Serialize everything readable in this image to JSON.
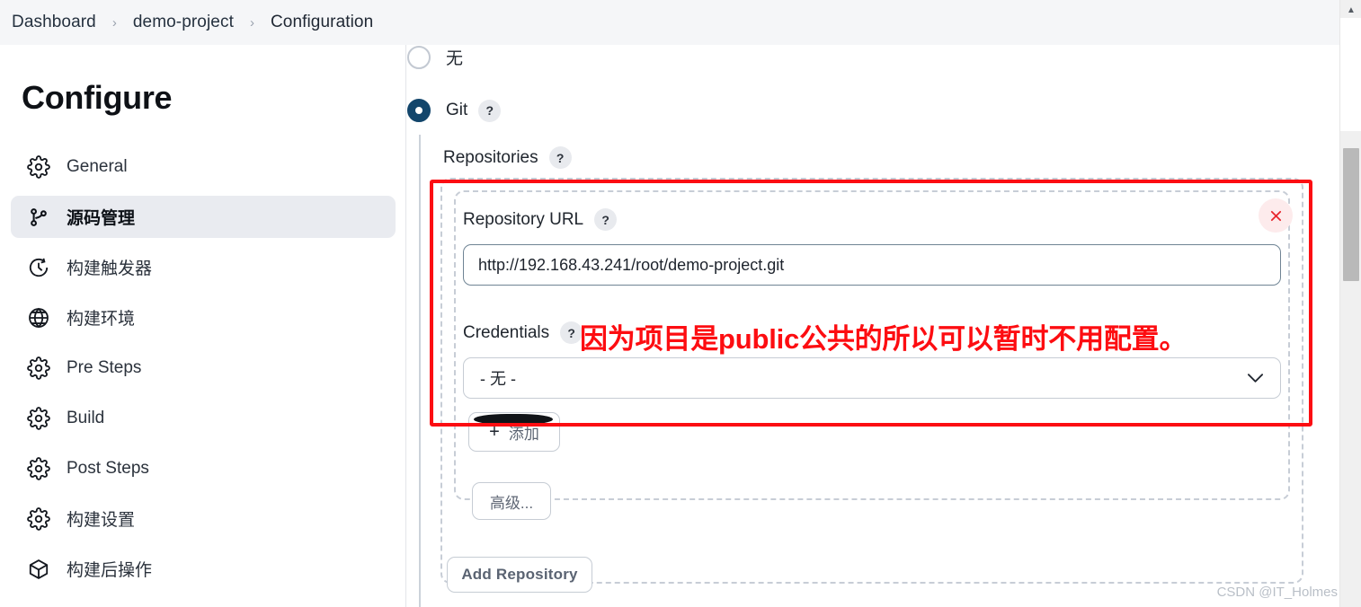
{
  "breadcrumb": {
    "items": [
      {
        "label": "Dashboard"
      },
      {
        "label": "demo-project"
      },
      {
        "label": "Configuration"
      }
    ],
    "separator": "›"
  },
  "sidebar": {
    "title": "Configure",
    "items": [
      {
        "label": "General",
        "icon": "gear-icon",
        "active": false
      },
      {
        "label": "源码管理",
        "icon": "git-branch-icon",
        "active": true
      },
      {
        "label": "构建触发器",
        "icon": "clock-icon",
        "active": false
      },
      {
        "label": "构建环境",
        "icon": "globe-icon",
        "active": false
      },
      {
        "label": "Pre Steps",
        "icon": "gear-icon",
        "active": false
      },
      {
        "label": "Build",
        "icon": "gear-icon",
        "active": false
      },
      {
        "label": "Post Steps",
        "icon": "gear-icon",
        "active": false
      },
      {
        "label": "构建设置",
        "icon": "gear-icon",
        "active": false
      },
      {
        "label": "构建后操作",
        "icon": "package-icon",
        "active": false
      }
    ]
  },
  "scm": {
    "options": [
      {
        "label": "无",
        "checked": false
      },
      {
        "label": "Git",
        "checked": true,
        "help": "?"
      }
    ],
    "repositories_label": "Repositories",
    "repositories_help": "?",
    "repository": {
      "url_label": "Repository URL",
      "url_help": "?",
      "url_value": "http://192.168.43.241/root/demo-project.git",
      "credentials_label": "Credentials",
      "credentials_help": "?",
      "credentials_value": "- 无 -",
      "credentials_chevron": "⌄",
      "remove_icon": "close-icon"
    },
    "add_button_label": "添加",
    "add_button_icon": "plus-icon",
    "advanced_button_label": "高级...",
    "add_repository_label": "Add Repository"
  },
  "annotation": {
    "text": "因为项目是public公共的所以可以暂时不用配置。",
    "box_color": "#fc0d12",
    "text_color": "#fd0d11"
  },
  "watermark": {
    "text": "CSDN @IT_Holmes"
  },
  "scrollbar": {
    "up_arrow": "▲",
    "down_arrow": "▼"
  },
  "colors": {
    "accent_navy": "#12456b",
    "sidebar_active_bg": "#e9ebf0",
    "annotation_red": "#fc0d12"
  }
}
